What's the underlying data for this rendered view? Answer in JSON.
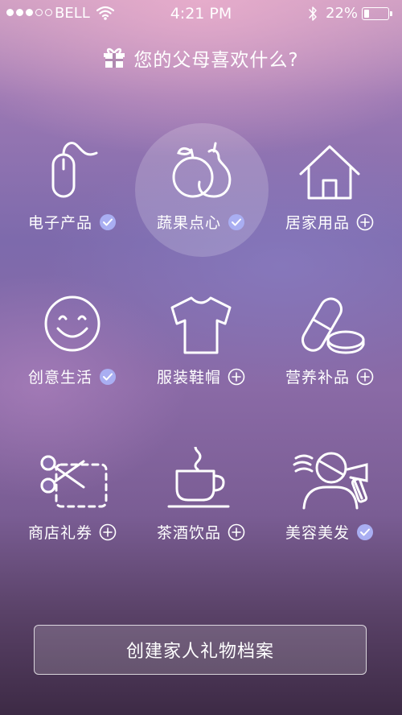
{
  "status_bar": {
    "signal_filled": 3,
    "signal_total": 5,
    "carrier": "BELL",
    "time": "4:21 PM",
    "battery_percent": "22%",
    "battery_level": 0.22
  },
  "header": {
    "icon": "gift-icon",
    "title": "您的父母喜欢什么?"
  },
  "colors": {
    "check_badge": "#a9aef2",
    "text": "#ffffff"
  },
  "categories": [
    {
      "label": "电子产品",
      "icon": "mouse-icon",
      "selected": true,
      "highlighted": false
    },
    {
      "label": "蔬果点心",
      "icon": "fruit-icon",
      "selected": true,
      "highlighted": true
    },
    {
      "label": "居家用品",
      "icon": "house-icon",
      "selected": false,
      "highlighted": false
    },
    {
      "label": "创意生活",
      "icon": "smiley-icon",
      "selected": true,
      "highlighted": false
    },
    {
      "label": "服装鞋帽",
      "icon": "tshirt-icon",
      "selected": false,
      "highlighted": false
    },
    {
      "label": "营养补品",
      "icon": "pill-icon",
      "selected": false,
      "highlighted": false
    },
    {
      "label": "商店礼券",
      "icon": "coupon-scissors-icon",
      "selected": false,
      "highlighted": false
    },
    {
      "label": "茶酒饮品",
      "icon": "tea-cup-icon",
      "selected": false,
      "highlighted": false
    },
    {
      "label": "美容美发",
      "icon": "hair-dryer-icon",
      "selected": true,
      "highlighted": false
    }
  ],
  "create_button": {
    "label": "创建家人礼物档案"
  }
}
